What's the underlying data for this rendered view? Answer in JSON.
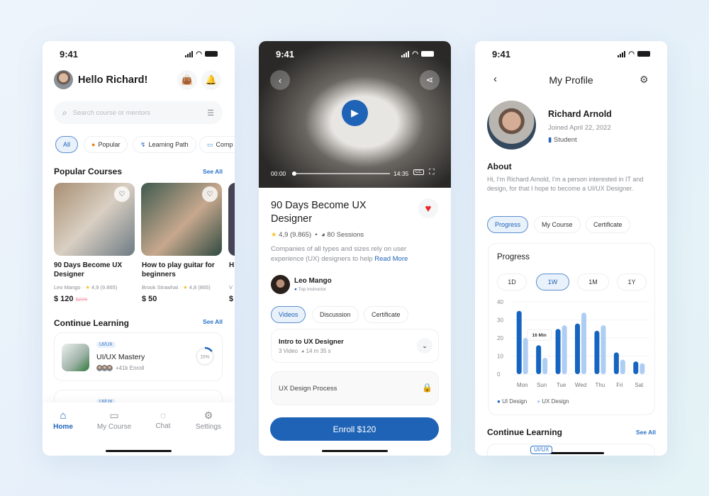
{
  "status_time": "9:41",
  "home": {
    "greeting": "Hello Richard!",
    "search_placeholder": "Search course or mentors",
    "chips": [
      "All",
      "Popular",
      "Learning Path",
      "Comp"
    ],
    "popular_title": "Popular Courses",
    "see_all": "See All",
    "courses": [
      {
        "title": "90 Days Become UX Designer",
        "author": "Leo Mango",
        "rating": "4,9 (9.865)",
        "price": "$ 120",
        "old_price": "$220"
      },
      {
        "title": "How to play guitar for beginners",
        "author": "Brook Strawhat",
        "rating": "4,8 (865)",
        "price": "$ 50"
      },
      {
        "title": "H b",
        "author": "V",
        "price": "$"
      }
    ],
    "continue_title": "Continue Learning",
    "learning": [
      {
        "tag": "UI/UX",
        "title": "UI/UX Mastery",
        "enroll": "+41k Enroll",
        "progress": "15%",
        "progress_value": 15
      },
      {
        "tag": "UI/UX"
      }
    ],
    "nav": [
      {
        "label": "Home",
        "icon": "home-icon"
      },
      {
        "label": "My Course",
        "icon": "video-icon"
      },
      {
        "label": "Chat",
        "icon": "chat-icon"
      },
      {
        "label": "Settings",
        "icon": "gear-icon"
      }
    ]
  },
  "course": {
    "time_current": "00:00",
    "time_total": "14:35",
    "cc": "CC",
    "title": "90 Days Become UX Designer",
    "rating": "4,9 (9.865)",
    "sessions": "80 Sessions",
    "description": "Companies of all types and sizes rely on user experience (UX) designers to help",
    "read_more": "Read More",
    "instructor": "Leo Mango",
    "instructor_badge": "Top Instructor",
    "tabs": [
      "Videos",
      "Discussion",
      "Certificate"
    ],
    "sections": [
      {
        "title": "Intro to UX Designer",
        "videos": "3 Video",
        "duration": "14 m 35 s"
      },
      {
        "title": "UX Design Process",
        "locked": true
      }
    ],
    "enroll": "Enroll $120"
  },
  "profile": {
    "title": "My Profile",
    "name": "Richard Arnold",
    "joined": "Joined April 22, 2022",
    "role": "Student",
    "about_title": "About",
    "about": "Hi, I'm Richard Arnold, I'm a person interested in IT and design, for that I hope to become a UI/UX Designer.",
    "tabs": [
      "Progress",
      "My Course",
      "Certificate"
    ],
    "progress_title": "Progress",
    "ranges": [
      "1D",
      "1W",
      "1M",
      "1Y"
    ],
    "tooltip": "16 Min",
    "continue_title": "Continue Learning",
    "see_all": "See All",
    "learning_tag": "UI/UX"
  },
  "colors": {
    "accent": "#1f63b7",
    "ui_series": "#1565c0",
    "ux_series": "#aecdf3"
  },
  "chart_data": {
    "type": "bar",
    "categories": [
      "Mon",
      "Sun",
      "Tue",
      "Wed",
      "Thu",
      "Fri",
      "Sat"
    ],
    "yticks": [
      0,
      10,
      20,
      30,
      40
    ],
    "ylim": [
      0,
      40
    ],
    "grid": true,
    "legend": "bottom-left",
    "series": [
      {
        "name": "UI Design",
        "values": [
          35,
          16,
          25,
          28,
          24,
          12,
          7
        ]
      },
      {
        "name": "UX Design",
        "values": [
          20,
          9,
          27,
          34,
          27,
          8,
          6
        ]
      }
    ]
  }
}
